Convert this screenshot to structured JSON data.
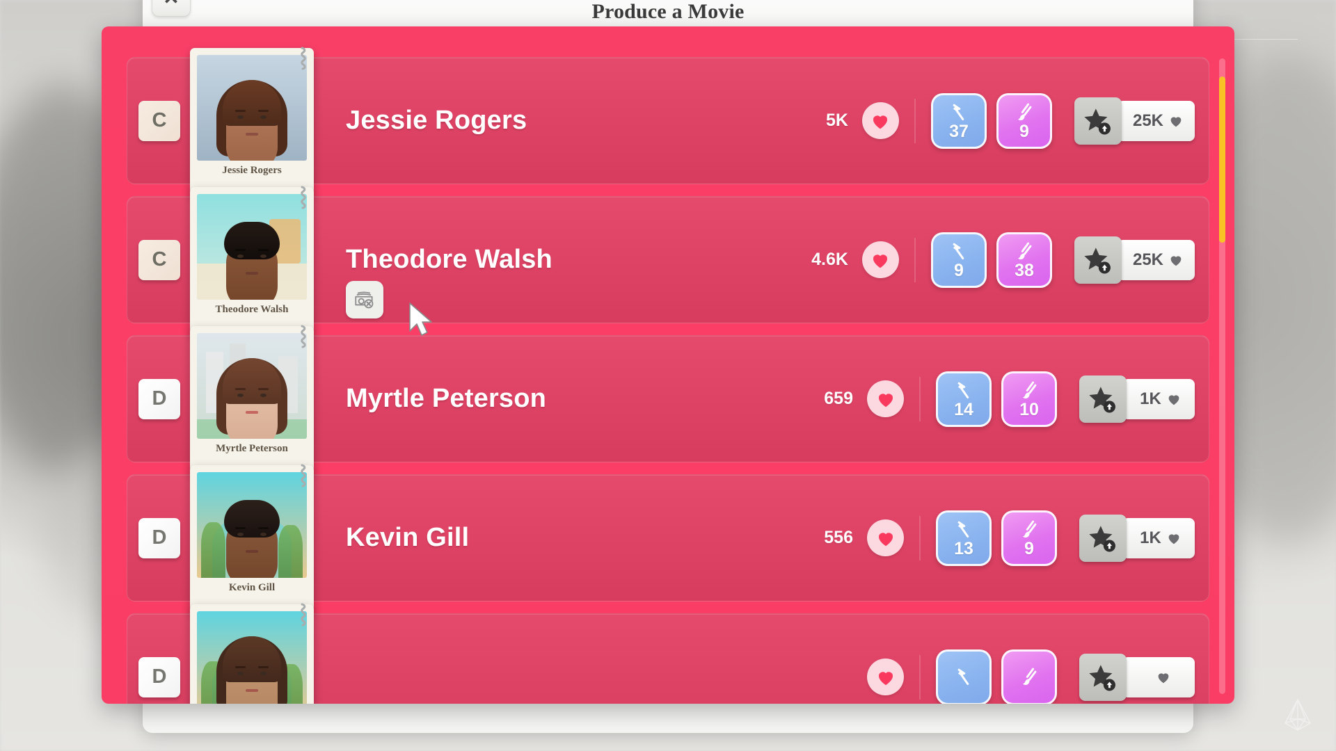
{
  "background": {
    "panel_title": "Produce a Movie",
    "close_label": "✕",
    "watermark_icon": "pyramid-logo-icon"
  },
  "theme": {
    "modal_pink": "#fa3f67",
    "row_pink": "#e43f63",
    "scrollbar_thumb": "#f7c325",
    "skill_blue": "#8ab4ef",
    "skill_purple": "#e173ef",
    "heart_red": "#f93a5e"
  },
  "modal": {
    "scrollbar": {
      "name": "vertical-scrollbar",
      "thumb_color": "#f7c325"
    },
    "icons": {
      "fans_heart": "heart-icon",
      "skill_blue": "hammer-icon",
      "skill_purple": "paintbrush-icon",
      "hire": "star-up-arrow-icon",
      "cost_heart": "heart-icon",
      "no_money": "money-blocked-icon"
    },
    "rows": [
      {
        "grade": "C",
        "grade_style": "cream",
        "name": "Jessie Rogers",
        "photo_caption": "Jessie Rogers",
        "fans": "5K",
        "skill_blue": "37",
        "skill_purple": "9",
        "cost": "25K",
        "no_money": false,
        "art": {
          "skyTop": "#c6d6e2",
          "skyBottom": "#9fb3c4",
          "skin": "#b4795a",
          "skinShade": "#9c6547",
          "hair": "#4e2b1b",
          "hairLight": "#6b3c25",
          "brow": "#3a2014",
          "mouth": "#8c4f42"
        }
      },
      {
        "grade": "C",
        "grade_style": "cream",
        "name": "Theodore Walsh",
        "photo_caption": "Theodore Walsh",
        "fans": "4.6K",
        "skill_blue": "9",
        "skill_purple": "38",
        "cost": "25K",
        "no_money": true,
        "art": {
          "skyTop": "#8fe0e0",
          "skyBottom": "#cfe9df",
          "skin": "#8c5a3c",
          "skinShade": "#734429",
          "hair": "#120d0b",
          "hairLight": "#241a14",
          "brow": "#0d0907",
          "mouth": "#6e3d30"
        }
      },
      {
        "grade": "D",
        "grade_style": "white",
        "name": "Myrtle Peterson",
        "photo_caption": "Myrtle Peterson",
        "fans": "659",
        "skill_blue": "14",
        "skill_purple": "10",
        "cost": "1K",
        "no_money": false,
        "art": {
          "skyTop": "#dfe7ec",
          "skyBottom": "#cddcd2",
          "skin": "#e8c3ac",
          "skinShade": "#d6ab92",
          "hair": "#5b3524",
          "hairLight": "#744630",
          "brow": "#44261a",
          "mouth": "#c4655f"
        }
      },
      {
        "grade": "D",
        "grade_style": "white",
        "name": "Kevin Gill",
        "photo_caption": "Kevin Gill",
        "fans": "556",
        "skill_blue": "13",
        "skill_purple": "9",
        "cost": "1K",
        "no_money": false,
        "art": {
          "skyTop": "#5fd4e0",
          "skyBottom": "#e9c98f",
          "skin": "#8a5a3c",
          "skinShade": "#71452a",
          "hair": "#1a1210",
          "hairLight": "#2c201a",
          "brow": "#120c09",
          "mouth": "#6d3c2f"
        }
      },
      {
        "grade": "D",
        "grade_style": "white",
        "name": "",
        "photo_caption": "",
        "fans": "",
        "skill_blue": "",
        "skill_purple": "",
        "cost": "",
        "no_money": false,
        "art": {
          "skyTop": "#5fd4e0",
          "skyBottom": "#e9c98f",
          "skin": "#c79a78",
          "skinShade": "#ae8059",
          "hair": "#43281c",
          "hairLight": "#5c3926",
          "brow": "#331d13",
          "mouth": "#a4584c"
        }
      }
    ]
  }
}
